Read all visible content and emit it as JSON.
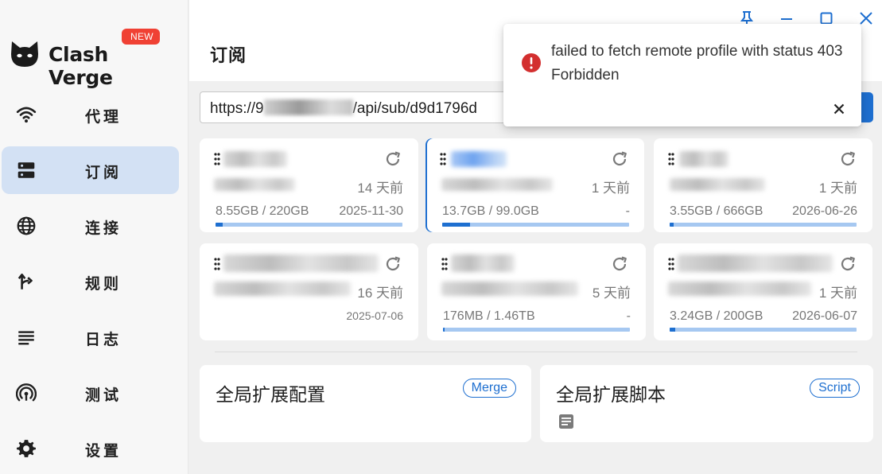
{
  "app": {
    "name": "Clash Verge",
    "badge": "NEW"
  },
  "sidebar": {
    "items": [
      {
        "label": "代理",
        "icon": "wifi-icon"
      },
      {
        "label": "订阅",
        "icon": "server-icon"
      },
      {
        "label": "连接",
        "icon": "globe-icon"
      },
      {
        "label": "规则",
        "icon": "route-icon"
      },
      {
        "label": "日志",
        "icon": "list-icon"
      },
      {
        "label": "测试",
        "icon": "radar-icon"
      },
      {
        "label": "设置",
        "icon": "gear-icon"
      }
    ],
    "active_index": 1
  },
  "header": {
    "title": "订阅"
  },
  "url_input": {
    "prefix": "https://9",
    "suffix": "/api/sub/d9d1796d"
  },
  "profiles": [
    {
      "updated": "14 天前",
      "usage": "8.55GB / 220GB",
      "expire": "2025-11-30",
      "progress": 0.04
    },
    {
      "updated": "1 天前",
      "usage": "13.7GB / 99.0GB",
      "expire": "-",
      "progress": 0.15
    },
    {
      "updated": "1 天前",
      "usage": "3.55GB / 666GB",
      "expire": "2026-06-26",
      "progress": 0.02
    },
    {
      "updated": "16 天前",
      "usage": "",
      "expire": "2025-07-06",
      "progress": null
    },
    {
      "updated": "5 天前",
      "usage": "176MB / 1.46TB",
      "expire": "-",
      "progress": 0.01
    },
    {
      "updated": "1 天前",
      "usage": "3.24GB / 200GB",
      "expire": "2026-06-07",
      "progress": 0.03
    }
  ],
  "extensions": {
    "merge": {
      "title": "全局扩展配置",
      "tag": "Merge"
    },
    "script": {
      "title": "全局扩展脚本",
      "tag": "Script"
    }
  },
  "notification": {
    "message": "failed to fetch remote profile with status 403 Forbidden"
  },
  "colors": {
    "accent": "#1e6fd0",
    "progress_track": "#a6c8f1",
    "active_nav": "#d3e1f4",
    "error": "#d32f2f",
    "new_badge": "#f04134"
  }
}
